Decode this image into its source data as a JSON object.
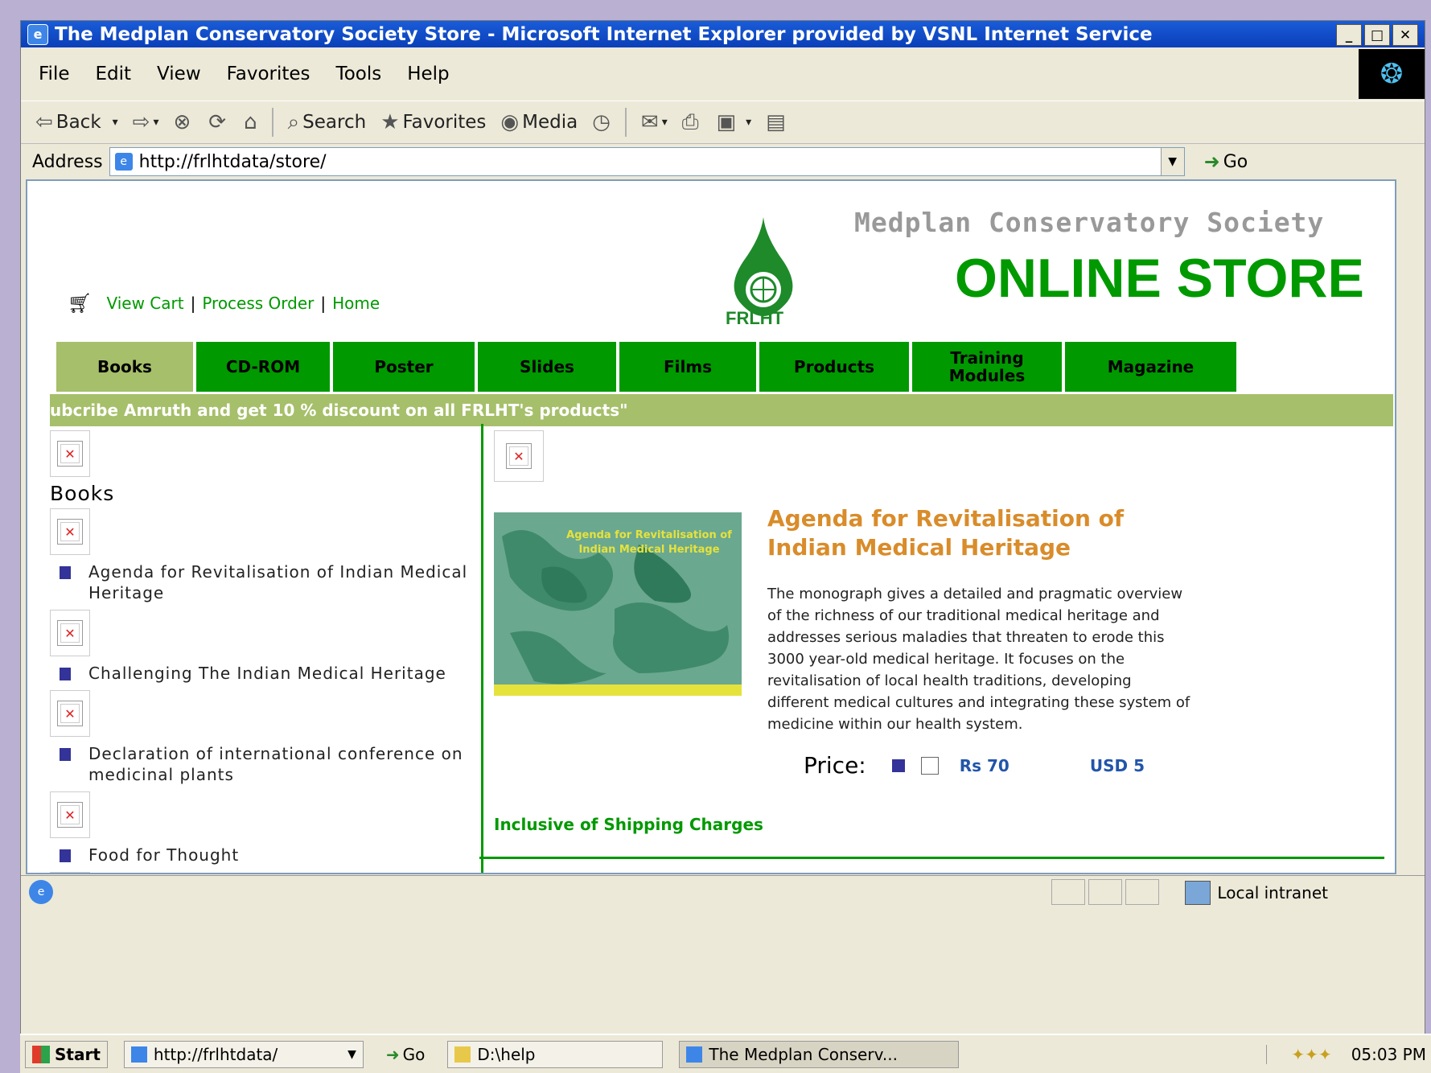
{
  "window": {
    "title": "The Medplan Conservatory Society Store - Microsoft Internet Explorer provided by VSNL Internet Service",
    "controls": [
      "_",
      "□",
      "✕"
    ]
  },
  "menu": [
    "File",
    "Edit",
    "View",
    "Favorites",
    "Tools",
    "Help"
  ],
  "toolbar": {
    "back": "Back",
    "search": "Search",
    "favorites": "Favorites",
    "media": "Media"
  },
  "address": {
    "label": "Address",
    "url": "http://frlhtdata/store/",
    "go": "Go"
  },
  "header": {
    "org": "Medplan Conservatory Society",
    "store": "ONLINE STORE",
    "logo_text": "FRLHT"
  },
  "toplinks": {
    "view_cart": "View Cart",
    "process_order": "Process Order",
    "home": "Home",
    "sep": "|"
  },
  "nav": [
    {
      "label": "Books",
      "active": true
    },
    {
      "label": "CD-ROM",
      "active": false
    },
    {
      "label": "Poster",
      "active": false
    },
    {
      "label": "Slides",
      "active": false
    },
    {
      "label": "Films",
      "active": false
    },
    {
      "label": "Products",
      "active": false
    },
    {
      "label": "Training Modules",
      "active": false
    },
    {
      "label": "Magazine",
      "active": false
    }
  ],
  "banner": "ubcribe Amruth and get 10 % discount on all FRLHT's products\"",
  "sidebar": {
    "heading": "Books",
    "items": [
      "Agenda for Revitalisation of Indian Medical Heritage",
      "Challenging The Indian Medical Heritage",
      "Declaration of international conference on medicinal plants",
      "Food for Thought"
    ]
  },
  "product": {
    "title": "Agenda for Revitalisation of Indian Medical Heritage",
    "cover_text": "Agenda for Revitalisation of Indian Medical Heritage",
    "description": "The monograph gives a detailed and pragmatic overview of the richness of our traditional medical heritage and addresses serious maladies that threaten to erode this 3000 year-old medical heritage. It focuses on the revitalisation of local health traditions, developing different medical cultures and integrating these system of medicine within our health system.",
    "price_label": "Price:",
    "price_inr": "Rs 70",
    "price_usd": "USD 5",
    "shipping": "Inclusive of Shipping Charges"
  },
  "status": {
    "zone": "Local intranet"
  },
  "taskbar": {
    "start": "Start",
    "address": "http://frlhtdata/",
    "go": "Go",
    "folder": "D:\\help",
    "window": "The Medplan Conserv...",
    "clock": "05:03 PM"
  },
  "colors": {
    "green": "#009900",
    "olive": "#a6bf6a",
    "orange": "#d98c2a",
    "blue": "#2255aa"
  }
}
